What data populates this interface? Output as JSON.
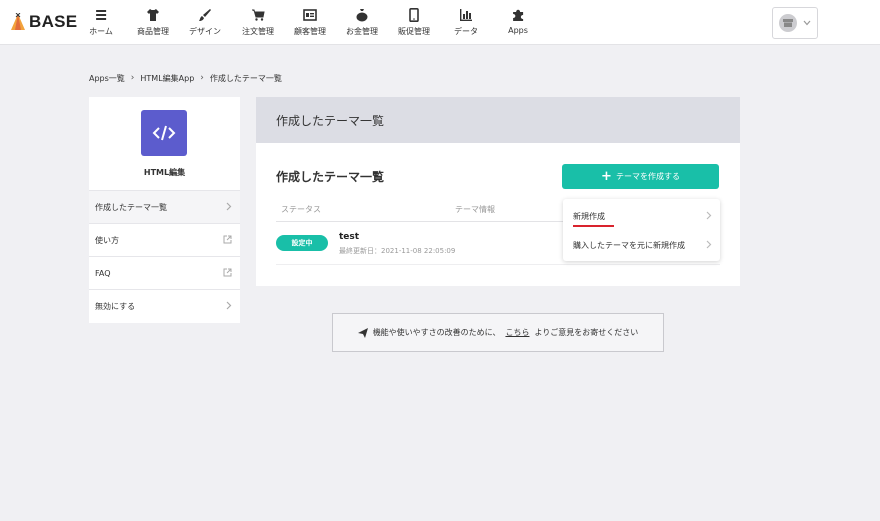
{
  "header": {
    "logo_text": "BASE",
    "nav": [
      {
        "label": "ホーム",
        "icon": "list-icon"
      },
      {
        "label": "商品管理",
        "icon": "tshirt-icon"
      },
      {
        "label": "デザイン",
        "icon": "brush-icon"
      },
      {
        "label": "注文管理",
        "icon": "cart-icon"
      },
      {
        "label": "顧客管理",
        "icon": "id-card-icon"
      },
      {
        "label": "お金管理",
        "icon": "money-bag-icon"
      },
      {
        "label": "販促管理",
        "icon": "phone-icon"
      },
      {
        "label": "データ",
        "icon": "bar-chart-icon"
      },
      {
        "label": "Apps",
        "icon": "puzzle-icon"
      }
    ]
  },
  "breadcrumb": [
    "Apps一覧",
    "HTML編集App",
    "作成したテーマ一覧"
  ],
  "app_card": {
    "name": "HTML編集",
    "menu": [
      {
        "label": "作成したテーマ一覧",
        "icon": "chevron-right-icon"
      },
      {
        "label": "使い方",
        "icon": "external-link-icon"
      },
      {
        "label": "FAQ",
        "icon": "external-link-icon"
      },
      {
        "label": "無効にする",
        "icon": "chevron-right-icon"
      }
    ]
  },
  "main": {
    "header_title": "作成したテーマ一覧",
    "section_title": "作成したテーマ一覧",
    "create_button": "テーマを作成する",
    "columns": [
      "ステータス",
      "テーマ情報"
    ],
    "rows": [
      {
        "status": "設定中",
        "name": "test",
        "updated": "最終更新日：2021-11-08 22:05:09"
      }
    ]
  },
  "dropdown": {
    "items": [
      "新規作成",
      "購入したテーマを元に新規作成"
    ]
  },
  "feedback": {
    "before": "機能や使いやすさの改善のために、",
    "link": "こちら",
    "after": "よりご意見をお寄せください"
  },
  "colors": {
    "accent": "#19bfa8",
    "app_icon": "#5c5ccd",
    "underline": "#d9232d"
  }
}
